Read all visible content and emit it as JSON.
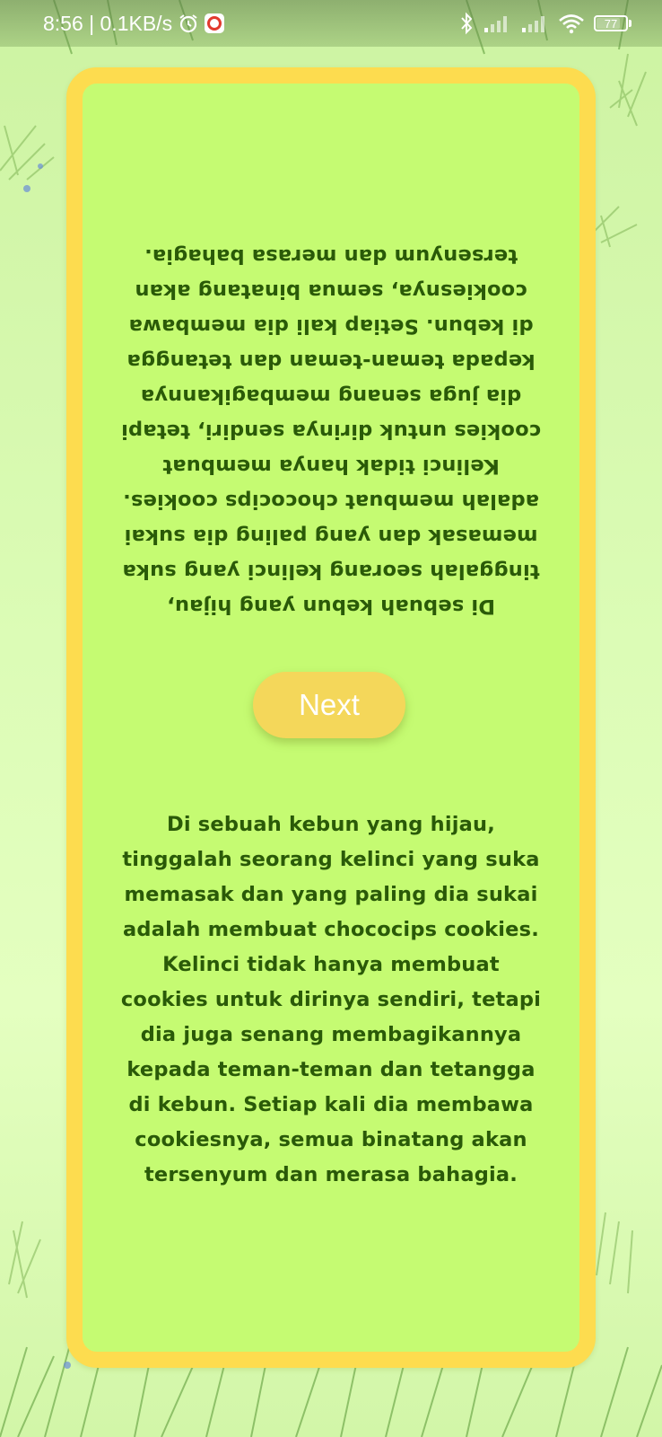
{
  "status_bar": {
    "time_speed": "8:56 | 0.1KB/s",
    "battery_level": "77",
    "icons": [
      "alarm-icon",
      "screen-record-icon",
      "bluetooth-icon",
      "signal-icon",
      "signal-icon",
      "wifi-icon",
      "battery-icon"
    ]
  },
  "story": {
    "text": "Di sebuah kebun yang hijau, tinggalah seorang kelinci yang suka memasak dan yang paling dia sukai adalah membuat chococips cookies. Kelinci tidak hanya membuat cookies untuk dirinya sendiri, tetapi dia juga senang membagikannya kepada teman-teman dan tetangga di kebun. Setiap kali dia membawa cookiesnya, semua binatang akan tersenyum dan merasa bahagia."
  },
  "controls": {
    "next_label": "Next"
  },
  "colors": {
    "card_background": "#c5fb72",
    "card_border": "#fddc4f",
    "button": "#f4d75a",
    "text": "#2a5a08"
  }
}
